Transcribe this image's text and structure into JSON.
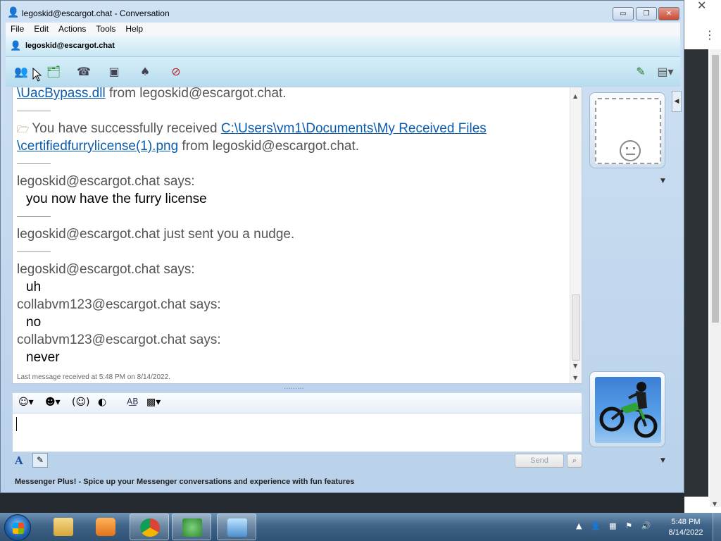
{
  "window": {
    "title": "legoskid@escargot.chat - Conversation",
    "buttons": {
      "minimize": "▭",
      "maximize": "❐",
      "close": "✕"
    }
  },
  "menu": [
    "File",
    "Edit",
    "Actions",
    "Tools",
    "Help"
  ],
  "contact": {
    "name": "legoskid@escargot.chat"
  },
  "toolbar_icons": [
    "invite-contact-icon",
    "share-files-icon",
    "call-icon",
    "video-icon",
    "games-icon",
    "block-contact-icon"
  ],
  "chat": {
    "messages": {
      "m0_link": "\\UacBypass.dll",
      "m0_tail": " from legoskid@escargot.chat.",
      "m1_prefix": "You have successfully received ",
      "m1_link1": "C:\\Users\\vm1\\Documents\\My Received Files",
      "m1_link2": "\\certifiedfurrylicense(1).png",
      "m1_tail": " from legoskid@escargot.chat.",
      "m2_sender": "legoskid@escargot.chat says:",
      "m2_body": "you now have the furry license",
      "m3_nudge": "legoskid@escargot.chat just sent you a nudge.",
      "m4_sender": "legoskid@escargot.chat says:",
      "m4_body": "uh",
      "m5_sender": "collabvm123@escargot.chat says:",
      "m5_body": "no",
      "m6_sender": "collabvm123@escargot.chat says:",
      "m6_body": "never"
    },
    "last_received": "Last message received at 5:48 PM on 8/14/2022."
  },
  "compose": {
    "send_label": "Send"
  },
  "plus_banner": "Messenger Plus! - Spice up your Messenger conversations and experience with fun features",
  "taskbar": {
    "time": "5:48 PM",
    "date": "8/14/2022"
  }
}
